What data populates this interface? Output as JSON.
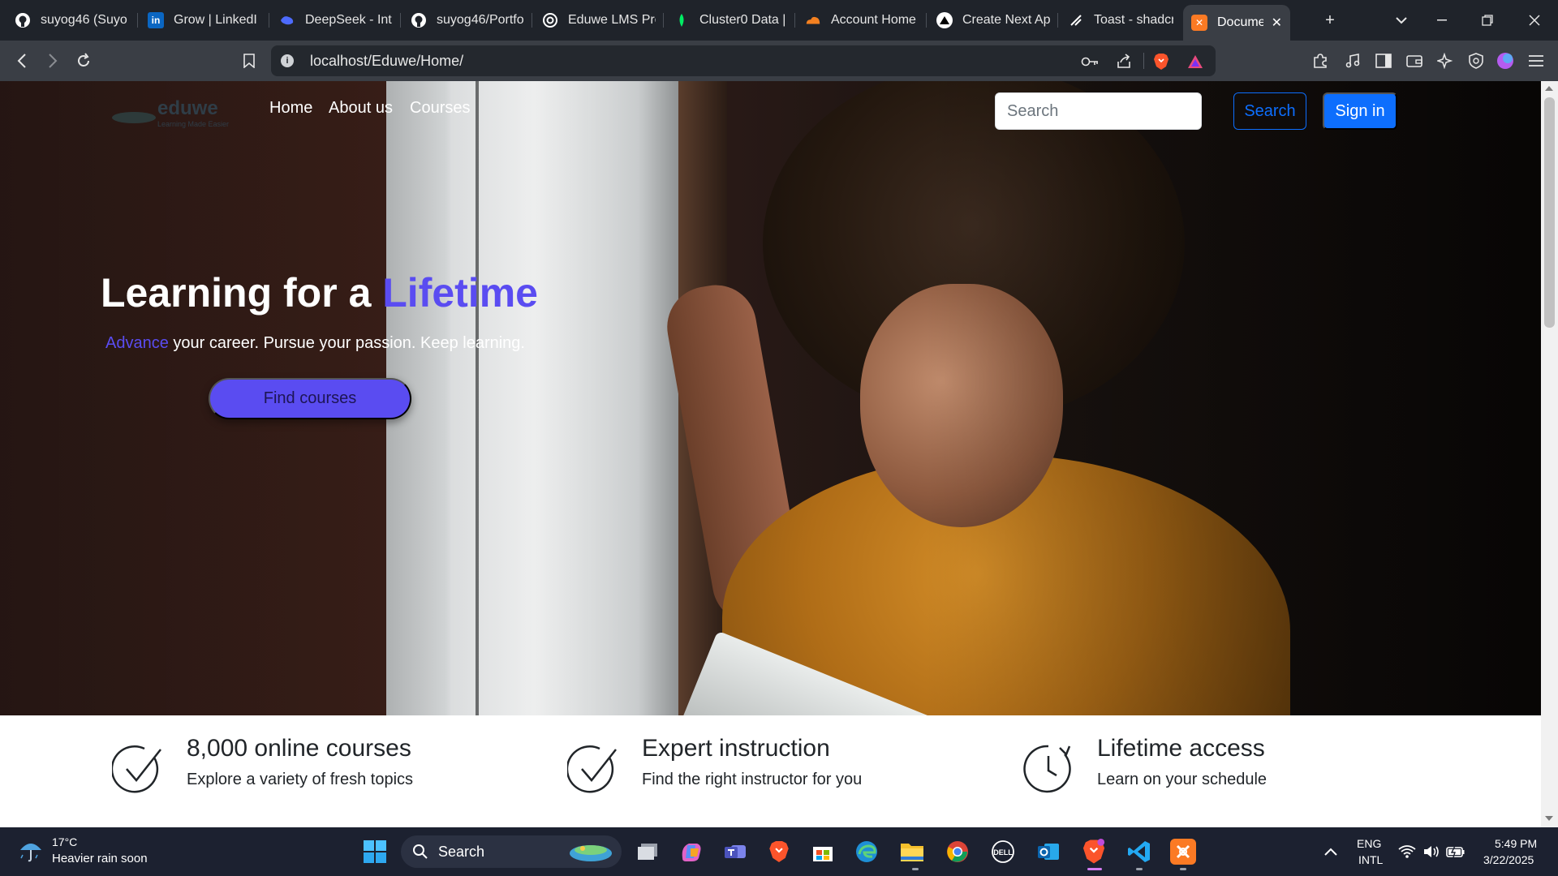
{
  "browser": {
    "tabs": [
      {
        "label": "suyog46 (Suyo",
        "icon": "github-icon"
      },
      {
        "label": "Grow | LinkedI",
        "icon": "linkedin-icon"
      },
      {
        "label": "DeepSeek - Int",
        "icon": "deepseek-icon"
      },
      {
        "label": "suyog46/Portfo",
        "icon": "github-icon"
      },
      {
        "label": "Eduwe LMS Pro",
        "icon": "openai-icon"
      },
      {
        "label": "Cluster0 Data |",
        "icon": "mongodb-icon"
      },
      {
        "label": "Account Home",
        "icon": "cloudflare-icon"
      },
      {
        "label": "Create Next Ap",
        "icon": "vercel-icon"
      },
      {
        "label": "Toast - shadcn",
        "icon": "shadcn-icon"
      },
      {
        "label": "Document",
        "icon": "xampp-icon",
        "active": true
      }
    ],
    "url": "localhost/Eduwe/Home/",
    "accent": "#3a3e45"
  },
  "site": {
    "logo": {
      "wordmark": "eduwe",
      "tagline": "Learning Made Easier"
    },
    "nav": [
      "Home",
      "About us",
      "Courses"
    ],
    "search_placeholder": "Search",
    "search_button": "Search",
    "signin_button": "Sign in",
    "hero": {
      "title_prefix": "Learning for a ",
      "title_accent": "Lifetime",
      "subtitle_accent": "Advance",
      "subtitle_rest": " your career. Pursue your passion. Keep learning.",
      "cta": "Find courses"
    },
    "features": [
      {
        "title": "8,000 online courses",
        "desc": "Explore a variety of fresh topics",
        "icon": "check-circle-icon"
      },
      {
        "title": "Expert instruction",
        "desc": "Find the right instructor for you",
        "icon": "check-circle-icon"
      },
      {
        "title": "Lifetime access",
        "desc": "Learn on your schedule",
        "icon": "clock-history-icon"
      }
    ],
    "accent_color": "#5a4cf1",
    "primary_color": "#0d6efd"
  },
  "taskbar": {
    "weather_temp": "17°C",
    "weather_desc": "Heavier rain soon",
    "search_label": "Search",
    "lang_top": "ENG",
    "lang_bottom": "INTL",
    "time": "5:49 PM",
    "date": "3/22/2025"
  }
}
